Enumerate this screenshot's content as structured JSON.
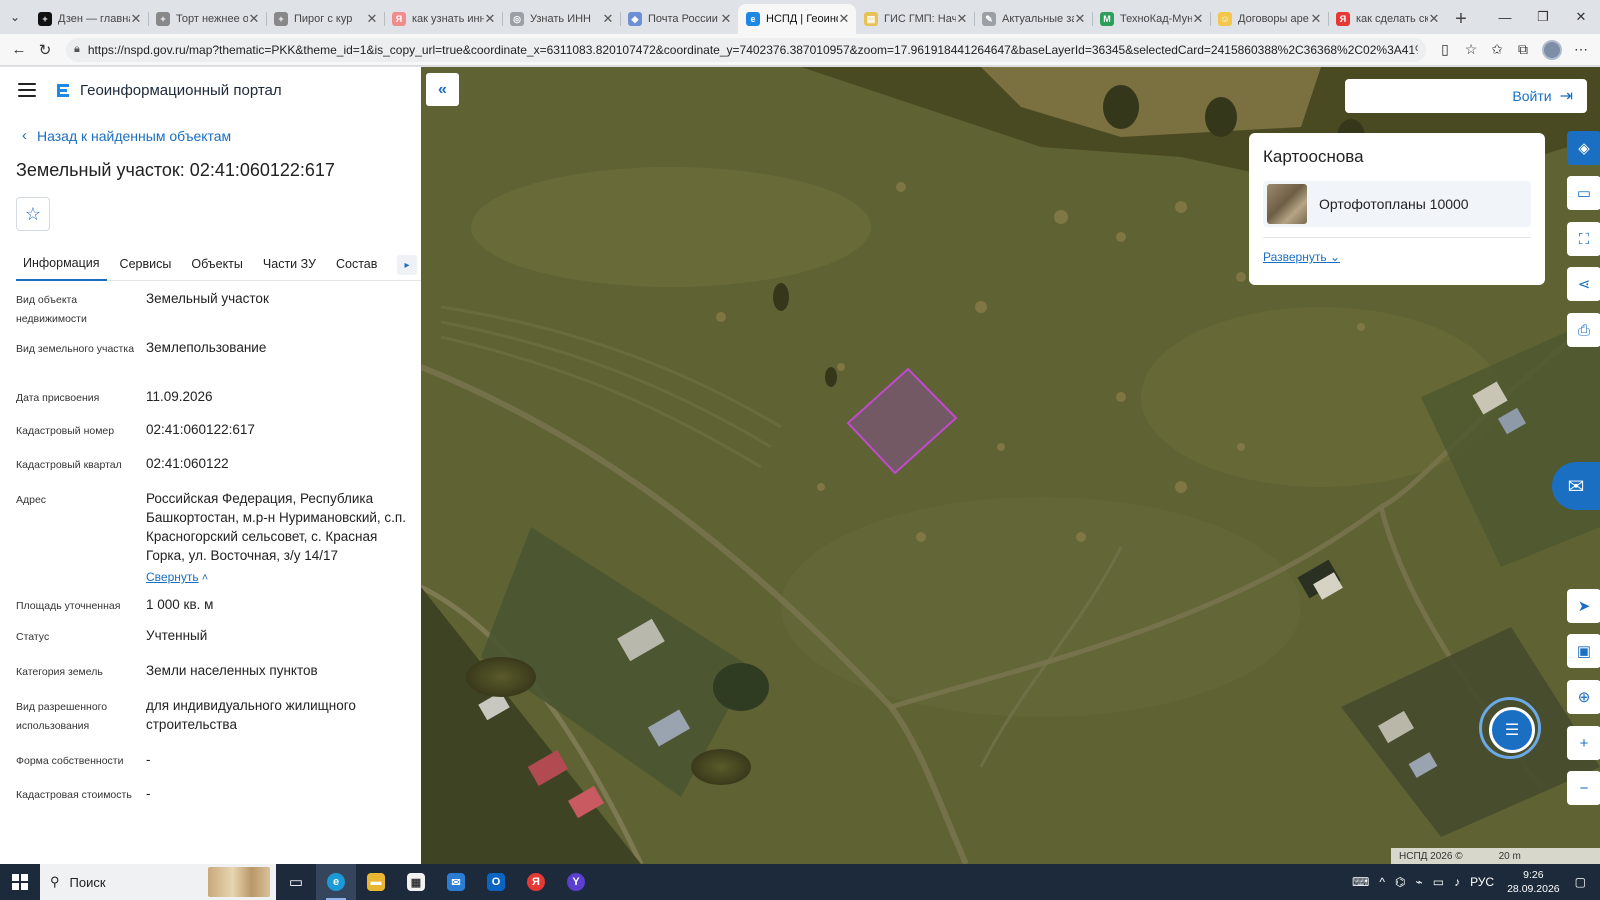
{
  "browser": {
    "tabs": [
      {
        "title": "Дзен — главна",
        "color": "#111111",
        "glyph": "+"
      },
      {
        "title": "Торт нежнее о",
        "color": "#888888",
        "glyph": "+"
      },
      {
        "title": "Пирог с кур",
        "color": "#888888",
        "glyph": "+"
      },
      {
        "title": "как узнать инн",
        "color": "#f28b8b",
        "glyph": "Я"
      },
      {
        "title": "Узнать ИНН",
        "color": "#9aa0a6",
        "glyph": "◎"
      },
      {
        "title": "Почта России",
        "color": "#6d8fd6",
        "glyph": "◆"
      },
      {
        "title": "НСПД | Геоинф",
        "color": "#1e88e5",
        "glyph": "e",
        "active": true
      },
      {
        "title": "ГИС ГМП: Нач",
        "color": "#e8c15a",
        "glyph": "▤"
      },
      {
        "title": "Актуальные за",
        "color": "#9aa0a6",
        "glyph": "✎"
      },
      {
        "title": "ТехноКад-Мун",
        "color": "#2e9e5b",
        "glyph": "M"
      },
      {
        "title": "Договоры аре",
        "color": "#f2c74b",
        "glyph": "☺"
      },
      {
        "title": "как сделать скр",
        "color": "#e53935",
        "glyph": "Я"
      }
    ],
    "url": "https://nspd.gov.ru/map?thematic=PKK&theme_id=1&is_copy_url=true&coordinate_x=6311083.820107472&coordinate_y=7402376.387010957&zoom=17.961918441264647&baseLayerId=36345&selectedCard=2415860388%2C36368%2C02%3A41%3A060122%3A617..."
  },
  "panel": {
    "portal_name": "Геоинформационный портал",
    "back_label": "Назад к найденным объектам",
    "title": "Земельный участок: 02:41:060122:617",
    "tabs": [
      "Информация",
      "Сервисы",
      "Объекты",
      "Части ЗУ",
      "Состав"
    ],
    "properties": [
      {
        "label": "Вид объекта недвижимости",
        "value": "Земельный участок"
      },
      {
        "label": "Вид земельного участка",
        "value": "Землепользование"
      },
      {
        "label": "Дата присвоения",
        "value": "11.09.2026"
      },
      {
        "label": "Кадастровый номер",
        "value": "02:41:060122:617"
      },
      {
        "label": "Кадастровый квартал",
        "value": "02:41:060122"
      },
      {
        "label": "Адрес",
        "value": "Российская Федерация, Республика Башкортостан, м.р-н Нуримановский, с.п. Красногорский сельсовет, с. Красная Горка, ул. Восточная, з/у 14/17"
      },
      {
        "label": "Площадь уточненная",
        "value": "1 000 кв. м"
      },
      {
        "label": "Статус",
        "value": "Учтенный"
      },
      {
        "label": "Категория земель",
        "value": "Земли населенных пунктов"
      },
      {
        "label": "Вид разрешенного использования",
        "value": "для индивидуального жилищного строительства"
      },
      {
        "label": "Форма собственности",
        "value": "-"
      },
      {
        "label": "Кадастровая стоимость",
        "value": "-"
      }
    ],
    "collapse_label": "Свернуть"
  },
  "map": {
    "login_label": "Войти",
    "basemap_title": "Картооснова",
    "basemap_layer": "Ортофотопланы 10000",
    "expand_label": "Развернуть",
    "copyright": "НСПД 2026 ©",
    "scale": "20 m"
  },
  "taskbar": {
    "search_label": "Поиск",
    "lang": "РУС",
    "time": "9:26",
    "date": "28.09.2026"
  }
}
